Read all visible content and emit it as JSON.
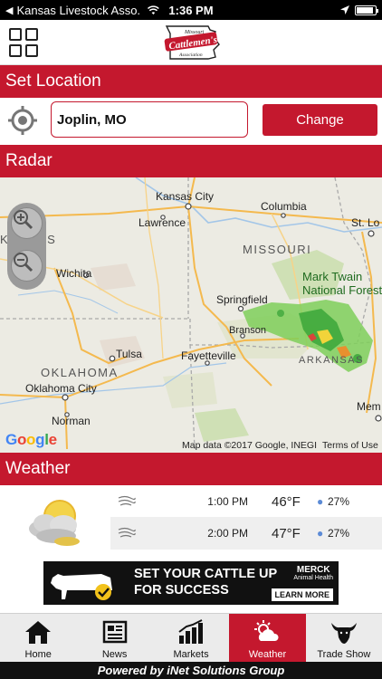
{
  "status_bar": {
    "back_arrow": "◀",
    "carrier": "Kansas Livestock Asso...",
    "time": "1:36 PM",
    "location_icon": "location-arrow-icon",
    "wifi_icon": "wifi-icon",
    "battery_level": 0.9
  },
  "header": {
    "logo": {
      "line1": "Missouri",
      "line2": "Cattlemen's",
      "line3": "Association"
    },
    "menu_icon": "grid-menu-icon"
  },
  "set_location": {
    "title": "Set Location",
    "input_value": "Joplin, MO",
    "change_label": "Change"
  },
  "radar": {
    "title": "Radar",
    "cities": [
      "Kansas City",
      "Lawrence",
      "Columbia",
      "St. Lo",
      "Wichita",
      "Springfield",
      "Branson",
      "Tulsa",
      "Fayetteville",
      "Oklahoma City",
      "Norman",
      "Mem"
    ],
    "states": [
      "MISSOURI",
      "K",
      "AS",
      "OKLAHOMA",
      "ARKANSAS"
    ],
    "park": [
      "Mark Twain",
      "National Forest"
    ],
    "google": "Google",
    "map_data": "Map data ©2017 Google, INEGI",
    "terms": "Terms of Use"
  },
  "weather": {
    "title": "Weather",
    "rows": [
      {
        "time": "1:00 PM",
        "temp": "46°F",
        "precip": "27%"
      },
      {
        "time": "2:00 PM",
        "temp": "47°F",
        "precip": "27%"
      }
    ]
  },
  "ad": {
    "line1": "SET YOUR CATTLE UP",
    "line2": "FOR SUCCESS",
    "brand": "MERCK",
    "brand_sub": "Animal Health",
    "cta": "LEARN MORE"
  },
  "tabs": [
    {
      "label": "Home",
      "icon": "home-icon"
    },
    {
      "label": "News",
      "icon": "newspaper-icon"
    },
    {
      "label": "Markets",
      "icon": "bar-chart-icon"
    },
    {
      "label": "Weather",
      "icon": "weather-icon",
      "active": true
    },
    {
      "label": "Trade Show",
      "icon": "bull-icon"
    }
  ],
  "footer": "Powered by iNet Solutions Group",
  "colors": {
    "brand_red": "#c4182e"
  }
}
